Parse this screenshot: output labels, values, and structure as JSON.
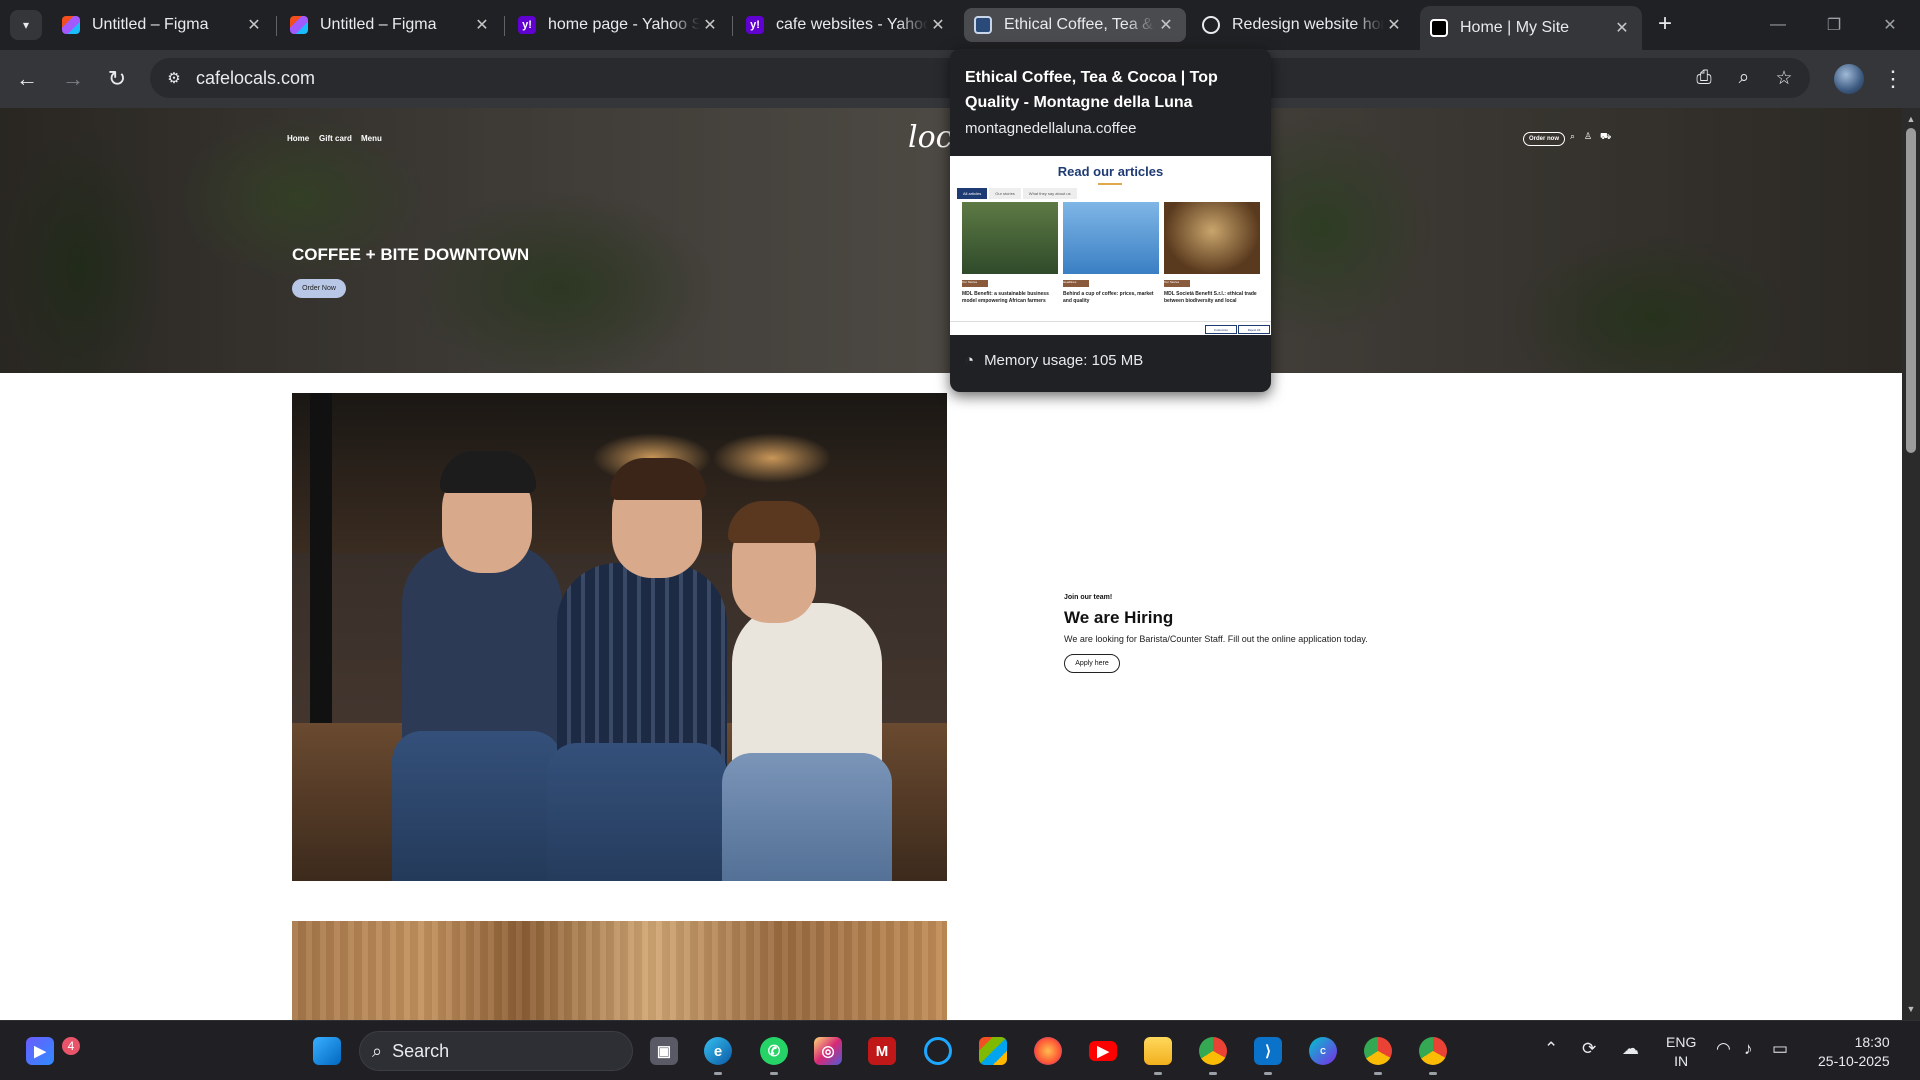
{
  "browser": {
    "tabs": [
      {
        "title": "Untitled – Figma",
        "favicon": "figma-icon"
      },
      {
        "title": "Untitled – Figma",
        "favicon": "figma-icon"
      },
      {
        "title": "home page - Yahoo Search",
        "favicon": "yahoo-icon"
      },
      {
        "title": "cafe websites - Yahoo Search",
        "favicon": "yahoo-icon"
      },
      {
        "title": "Ethical Coffee, Tea & Cocoa",
        "favicon": "site-icon"
      },
      {
        "title": "Redesign website home",
        "favicon": "chatgpt-icon"
      },
      {
        "title": "Home | My Site",
        "favicon": "wix-icon"
      }
    ],
    "active_tab_index": 6,
    "hovered_tab_index": 4,
    "url": "cafelocals.com"
  },
  "hover_card": {
    "title": "Ethical Coffee, Tea & Cocoa | Top Quality - Montagne della Luna",
    "domain": "montagnedellaluna.coffee",
    "preview": {
      "heading": "Read our articles",
      "tabs": [
        "All articles",
        "Our stories",
        "What they say about us"
      ],
      "cards": [
        {
          "chip": "Our Stories",
          "text": "MDL Benefit: a sustainable business model empowering African farmers"
        },
        {
          "chip": "Headlines",
          "text": "Behind a cup of coffee: prices, market and quality"
        },
        {
          "chip": "Our Stories",
          "text": "MDL Società Benefit S.r.l.: ethical trade between biodiversity and local"
        }
      ],
      "consent_buttons": [
        "Customize",
        "Reject All"
      ]
    },
    "memory_usage": "Memory usage: 105 MB"
  },
  "site": {
    "nav": [
      "Home",
      "Gift card",
      "Menu"
    ],
    "logo": "loc",
    "order_now_small": "Order now",
    "hero_title": "COFFEE + BITE DOWNTOWN",
    "hero_button": "Order Now",
    "hiring": {
      "kicker": "Join our team!",
      "title": "We are Hiring",
      "text": "We are looking for Barista/Counter Staff. Fill out the online application today.",
      "button": "Apply here"
    }
  },
  "taskbar": {
    "search_placeholder": "Search",
    "notification_count": "4",
    "language": "ENG",
    "region": "IN",
    "time": "18:30",
    "date": "25-10-2025"
  }
}
